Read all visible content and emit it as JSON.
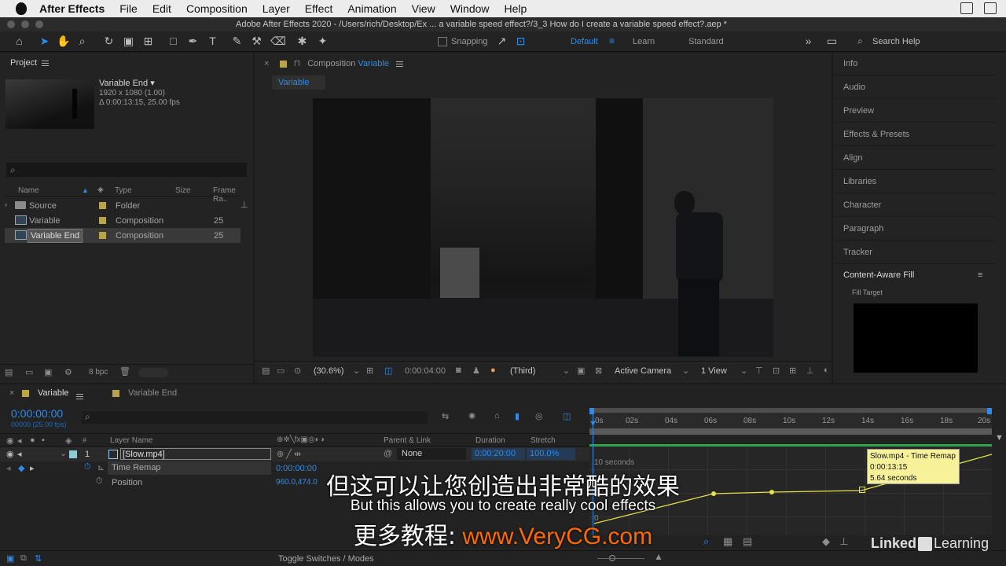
{
  "menubar": {
    "app_name": "After Effects",
    "items": [
      "File",
      "Edit",
      "Composition",
      "Layer",
      "Effect",
      "Animation",
      "View",
      "Window",
      "Help"
    ]
  },
  "window_title": "Adobe After Effects 2020 - /Users/rich/Desktop/Ex ... a variable speed effect?/3_3 How do I create a variable speed effect?.aep *",
  "toolbar": {
    "snapping_label": "Snapping",
    "workspaces": [
      "Default",
      "Learn",
      "Standard"
    ],
    "active_workspace": "Default",
    "search_placeholder": "Search Help"
  },
  "project": {
    "title": "Project",
    "selected": {
      "name": "Variable End ▾",
      "size": "1920 x 1080 (1.00)",
      "duration": "Δ 0:00:13:15, 25.00 fps"
    },
    "columns": {
      "name": "Name",
      "type": "Type",
      "size": "Size",
      "frame_rate": "Frame Ra.."
    },
    "items": [
      {
        "name": "Source",
        "type": "Folder",
        "rate": ""
      },
      {
        "name": "Variable",
        "type": "Composition",
        "rate": "25"
      },
      {
        "name": "Variable End",
        "type": "Composition",
        "rate": "25"
      }
    ],
    "bpc": "8 bpc"
  },
  "composition": {
    "header_prefix": "Composition",
    "header_name": "Variable",
    "tab": "Variable",
    "footer": {
      "zoom": "(30.6%)",
      "timecode": "0:00:04:00",
      "resolution": "(Third)",
      "camera": "Active Camera",
      "views": "1 View"
    }
  },
  "right_panels": [
    "Info",
    "Audio",
    "Preview",
    "Effects & Presets",
    "Align",
    "Libraries",
    "Character",
    "Paragraph",
    "Tracker"
  ],
  "content_aware_fill": {
    "title": "Content-Aware Fill",
    "fill_target": "Fill Target"
  },
  "timeline": {
    "tabs": [
      "Variable",
      "Variable End"
    ],
    "timecode": "0:00:00:00",
    "frames": "00000 (25.00 fps)",
    "columns": {
      "layer_name": "Layer Name",
      "parent": "Parent & Link",
      "duration": "Duration",
      "stretch": "Stretch"
    },
    "layer": {
      "index": "1",
      "name": "[Slow.mp4]",
      "parent": "None",
      "duration": "0:00:20:00",
      "stretch": "100.0%"
    },
    "properties": [
      {
        "name": "Time Remap",
        "value": "0:00:00:00"
      },
      {
        "name": "Position",
        "value": "960.0,474.0"
      }
    ],
    "ruler": [
      "0s",
      "02s",
      "04s",
      "06s",
      "08s",
      "10s",
      "12s",
      "14s",
      "16s",
      "18s",
      "20s"
    ],
    "graph_label": "10 seconds",
    "tooltip": {
      "title": "Slow.mp4 - Time Remap",
      "time": "0:00:13:15",
      "value": "5.64 seconds"
    },
    "toggle_label": "Toggle Switches / Modes",
    "zero_label": "0"
  },
  "subtitles": {
    "chinese": "但这可以让您创造出非常酷的效果",
    "english": "But this allows you to create really cool effects",
    "watermark_prefix": "更多教程:",
    "watermark_url": "www.VeryCG.com"
  },
  "branding": {
    "linkedin": "Linked",
    "learning": "Learning"
  },
  "colors": {
    "accent": "#2d8ceb",
    "label_yellow": "#b9a44a",
    "tooltip_bg": "#f7f29a",
    "watermark": "#ff6a00"
  }
}
